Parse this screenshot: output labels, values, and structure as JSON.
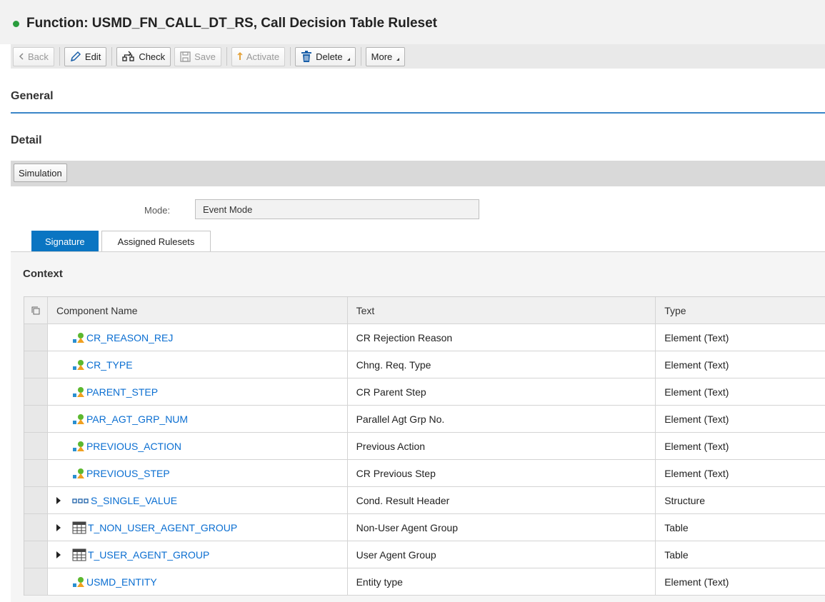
{
  "page": {
    "title": "Function: USMD_FN_CALL_DT_RS, Call Decision Table Ruleset",
    "status_color": "#2a9d3d"
  },
  "toolbar": {
    "back": "Back",
    "edit": "Edit",
    "check": "Check",
    "save": "Save",
    "activate": "Activate",
    "delete": "Delete",
    "more": "More"
  },
  "sections": {
    "general": "General",
    "detail": "Detail"
  },
  "detail": {
    "simulation_button": "Simulation",
    "mode_label": "Mode:",
    "mode_value": "Event Mode"
  },
  "tabs": [
    {
      "label": "Signature",
      "active": true
    },
    {
      "label": "Assigned Rulesets",
      "active": false
    }
  ],
  "context": {
    "title": "Context",
    "columns": [
      "Component Name",
      "Text",
      "Type"
    ],
    "rows": [
      {
        "name": "CR_REASON_REJ",
        "text": "CR Rejection Reason",
        "type": "Element (Text)",
        "icon": "element-icon",
        "expandable": false
      },
      {
        "name": "CR_TYPE",
        "text": "Chng. Req. Type",
        "type": "Element (Text)",
        "icon": "element-icon",
        "expandable": false
      },
      {
        "name": "PARENT_STEP",
        "text": "CR Parent Step",
        "type": "Element (Text)",
        "icon": "element-icon",
        "expandable": false
      },
      {
        "name": "PAR_AGT_GRP_NUM",
        "text": "Parallel Agt Grp No.",
        "type": "Element (Text)",
        "icon": "element-icon",
        "expandable": false
      },
      {
        "name": "PREVIOUS_ACTION",
        "text": "Previous Action",
        "type": "Element (Text)",
        "icon": "element-icon",
        "expandable": false
      },
      {
        "name": "PREVIOUS_STEP",
        "text": "CR Previous Step",
        "type": "Element (Text)",
        "icon": "element-icon",
        "expandable": false
      },
      {
        "name": "S_SINGLE_VALUE",
        "text": "Cond. Result Header",
        "type": "Structure",
        "icon": "structure-icon",
        "expandable": true
      },
      {
        "name": "T_NON_USER_AGENT_GROUP",
        "text": "Non-User Agent Group",
        "type": "Table",
        "icon": "table-icon",
        "expandable": true
      },
      {
        "name": "T_USER_AGENT_GROUP",
        "text": "User Agent Group",
        "type": "Table",
        "icon": "table-icon",
        "expandable": true
      },
      {
        "name": "USMD_ENTITY",
        "text": "Entity type",
        "type": "Element (Text)",
        "icon": "element-icon",
        "expandable": false
      }
    ]
  }
}
